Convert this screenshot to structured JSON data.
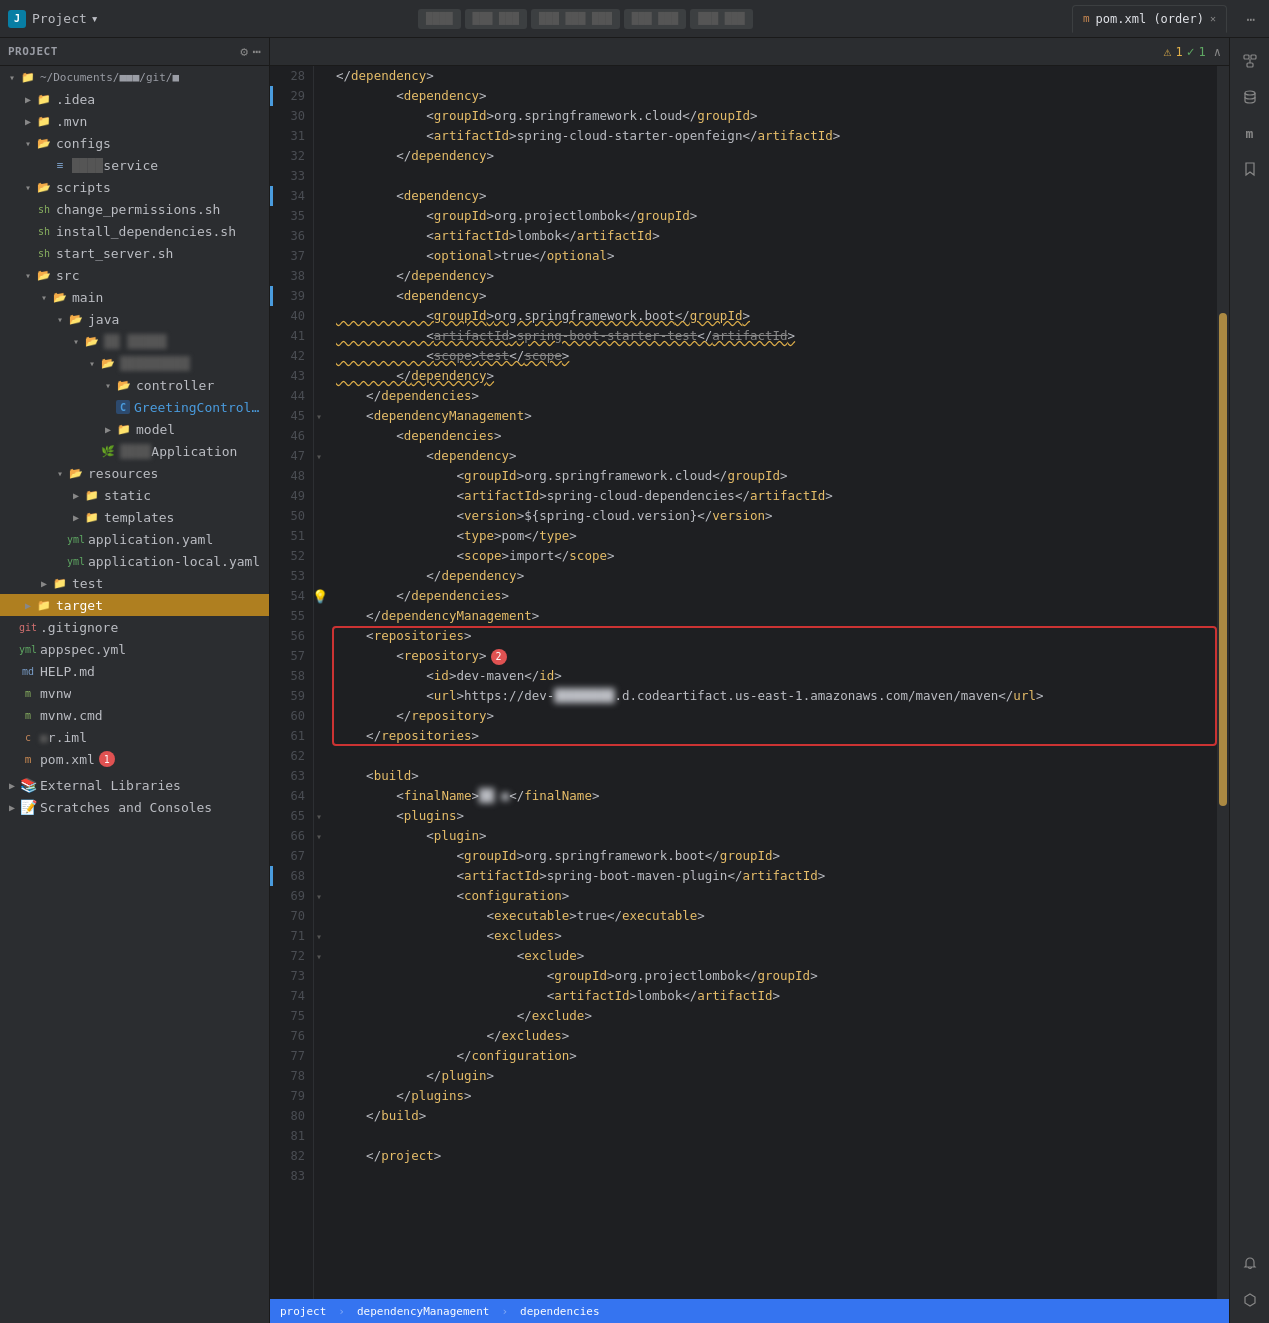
{
  "titleBar": {
    "logo": "J",
    "projectLabel": "Project",
    "dropdownIcon": "▾",
    "tabs": [
      {
        "id": "pom",
        "label": "pom.xml (order)",
        "icon": "m",
        "active": true
      }
    ],
    "actions": [
      "←",
      "→",
      "↺",
      "⋯"
    ]
  },
  "toolbar": {
    "pills": [
      "▓▓▓",
      "▓▓▓ ▓▓▓",
      "▓▓▓ ▓▓▓ ▓▓▓",
      "▓▓▓ ▓▓▓",
      "▓▓▓ ▓▓▓"
    ]
  },
  "sidebar": {
    "title": "Project",
    "rootLabel": "~/Documents/…/git/…",
    "items": [
      {
        "id": "idea",
        "label": ".idea",
        "depth": 1,
        "type": "folder",
        "expanded": false
      },
      {
        "id": "mvn",
        "label": ".mvn",
        "depth": 1,
        "type": "folder",
        "expanded": false
      },
      {
        "id": "configs",
        "label": "configs",
        "depth": 1,
        "type": "folder-open",
        "expanded": true
      },
      {
        "id": "service",
        "label": "service",
        "depth": 2,
        "type": "file-config",
        "blurred": true
      },
      {
        "id": "scripts",
        "label": "scripts",
        "depth": 1,
        "type": "folder-open",
        "expanded": true
      },
      {
        "id": "change_permissions",
        "label": "change_permissions.sh",
        "depth": 2,
        "type": "sh"
      },
      {
        "id": "install_dependencies",
        "label": "install_dependencies.sh",
        "depth": 2,
        "type": "sh"
      },
      {
        "id": "start_server",
        "label": "start_server.sh",
        "depth": 2,
        "type": "sh"
      },
      {
        "id": "src",
        "label": "src",
        "depth": 1,
        "type": "folder-open",
        "expanded": true
      },
      {
        "id": "main",
        "label": "main",
        "depth": 2,
        "type": "folder-open",
        "expanded": true
      },
      {
        "id": "java",
        "label": "java",
        "depth": 3,
        "type": "folder-open",
        "expanded": true
      },
      {
        "id": "pkg",
        "label": "■■ ■■■■■",
        "depth": 4,
        "type": "folder-open",
        "expanded": true,
        "blurred": true
      },
      {
        "id": "pkg2",
        "label": "■■■■■■■■■",
        "depth": 5,
        "type": "folder-open",
        "expanded": true,
        "blurred": true
      },
      {
        "id": "controller",
        "label": "controller",
        "depth": 6,
        "type": "folder-open",
        "expanded": true
      },
      {
        "id": "GreetingController",
        "label": "GreetingController",
        "depth": 7,
        "type": "java-class",
        "icon": "C"
      },
      {
        "id": "model",
        "label": "model",
        "depth": 6,
        "type": "folder",
        "expanded": false
      },
      {
        "id": "Application",
        "label": "■■■■Application",
        "depth": 6,
        "type": "spring",
        "blurred": true
      },
      {
        "id": "resources",
        "label": "resources",
        "depth": 3,
        "type": "folder-open",
        "expanded": true
      },
      {
        "id": "static",
        "label": "static",
        "depth": 4,
        "type": "folder",
        "expanded": false
      },
      {
        "id": "templates",
        "label": "templates",
        "depth": 4,
        "type": "folder",
        "expanded": false
      },
      {
        "id": "application_yml",
        "label": "application.yaml",
        "depth": 4,
        "type": "yml"
      },
      {
        "id": "application_local_yml",
        "label": "application-local.yaml",
        "depth": 4,
        "type": "yml"
      },
      {
        "id": "test",
        "label": "test",
        "depth": 2,
        "type": "folder",
        "expanded": false
      },
      {
        "id": "target",
        "label": "target",
        "depth": 1,
        "type": "folder-open",
        "expanded": false,
        "selected": true
      },
      {
        "id": "gitignore",
        "label": ".gitignore",
        "depth": 1,
        "type": "gitignore"
      },
      {
        "id": "appspec",
        "label": "appspec.yml",
        "depth": 1,
        "type": "yml"
      },
      {
        "id": "helpmd",
        "label": "HELP.md",
        "depth": 1,
        "type": "md"
      },
      {
        "id": "mvnw",
        "label": "mvnw",
        "depth": 1,
        "type": "sh"
      },
      {
        "id": "mvnwcmd",
        "label": "mvnw.cmd",
        "depth": 1,
        "type": "sh"
      },
      {
        "id": "riml",
        "label": "■ r.iml",
        "depth": 1,
        "type": "iml",
        "blurred": true
      },
      {
        "id": "pomxml",
        "label": "pom.xml",
        "depth": 1,
        "type": "xml",
        "badge": 1
      }
    ],
    "sections": [
      {
        "id": "external-libraries",
        "label": "External Libraries",
        "expanded": false
      },
      {
        "id": "scratches",
        "label": "Scratches and Consoles",
        "expanded": false
      }
    ]
  },
  "editorTab": {
    "icon": "m",
    "label": "pom.xml (order)",
    "closable": true
  },
  "editorToolbar": {
    "warningCount": "1",
    "errorCount": "1",
    "expandIcon": "⌃"
  },
  "codeLines": [
    {
      "num": 28,
      "content": "        </dependency>",
      "indent": 2
    },
    {
      "num": 29,
      "content": "        <dependency>",
      "indent": 2,
      "gitMark": "modified"
    },
    {
      "num": 30,
      "content": "            <groupId>org.springframework.cloud</groupId>",
      "indent": 3
    },
    {
      "num": 31,
      "content": "            <artifactId>spring-cloud-starter-openfeign</artifactId>",
      "indent": 3
    },
    {
      "num": 32,
      "content": "        </dependency>",
      "indent": 2
    },
    {
      "num": 33,
      "content": ""
    },
    {
      "num": 34,
      "content": "        <dependency>",
      "indent": 2,
      "gitMark": "modified"
    },
    {
      "num": 35,
      "content": "            <groupId>org.projectlombok</groupId>",
      "indent": 3
    },
    {
      "num": 36,
      "content": "            <artifactId>lombok</artifactId>",
      "indent": 3
    },
    {
      "num": 37,
      "content": "            <optional>true</optional>",
      "indent": 3
    },
    {
      "num": 38,
      "content": "        </dependency>",
      "indent": 2
    },
    {
      "num": 39,
      "content": "        <dependency>",
      "indent": 2,
      "gitMark": "modified"
    },
    {
      "num": 40,
      "content": "            <groupId>org.springframework.boot</groupId>",
      "indent": 3,
      "warnStyle": true
    },
    {
      "num": 41,
      "content": "            <artifactId>spring-boot-starter-test</artifactId>",
      "indent": 3,
      "warnStyle": true,
      "strike": true
    },
    {
      "num": 42,
      "content": "            <scope>test</scope>",
      "indent": 3,
      "warnStyle": true,
      "strike": true
    },
    {
      "num": 43,
      "content": "        </dependency>",
      "indent": 2,
      "warnStyle": true
    },
    {
      "num": 44,
      "content": "    </dependencies>",
      "indent": 1
    },
    {
      "num": 45,
      "content": "    <dependencyManagement>",
      "indent": 1,
      "foldable": true
    },
    {
      "num": 46,
      "content": "        <dependencies>",
      "indent": 2
    },
    {
      "num": 47,
      "content": "            <dependency>",
      "indent": 3,
      "foldable": true
    },
    {
      "num": 48,
      "content": "                <groupId>org.springframework.cloud</groupId>",
      "indent": 4
    },
    {
      "num": 49,
      "content": "                <artifactId>spring-cloud-dependencies</artifactId>",
      "indent": 4
    },
    {
      "num": 50,
      "content": "                <version>${spring-cloud.version}</version>",
      "indent": 4
    },
    {
      "num": 51,
      "content": "                <type>pom</type>",
      "indent": 4
    },
    {
      "num": 52,
      "content": "                <scope>import</scope>",
      "indent": 4
    },
    {
      "num": 53,
      "content": "            </dependency>",
      "indent": 3
    },
    {
      "num": 54,
      "content": "        </dependencies>",
      "indent": 2,
      "lightbulb": true
    },
    {
      "num": 55,
      "content": "    </dependencyManagement>",
      "indent": 1
    },
    {
      "num": 56,
      "content": "    <repositories>",
      "indent": 1,
      "errorRegionStart": true
    },
    {
      "num": 57,
      "content": "        <repository>",
      "indent": 2,
      "badge": 2
    },
    {
      "num": 58,
      "content": "            <id>dev-maven</id>",
      "indent": 3
    },
    {
      "num": 59,
      "content": "            <url>https://dev-■■■■■■■■■.d.codeartifact.us-east-1.amazonaws.com/maven/maven</url>",
      "indent": 3,
      "blurred": true
    },
    {
      "num": 60,
      "content": "        </repository>",
      "indent": 2
    },
    {
      "num": 61,
      "content": "    </repositories>",
      "indent": 1,
      "errorRegionEnd": true
    },
    {
      "num": 62,
      "content": ""
    },
    {
      "num": 63,
      "content": "    <build>",
      "indent": 1
    },
    {
      "num": 64,
      "content": "        <finalName>■■ ■</finalName>",
      "indent": 2,
      "blurred": true
    },
    {
      "num": 65,
      "content": "        <plugins>",
      "indent": 2,
      "foldable": true
    },
    {
      "num": 66,
      "content": "            <plugin>",
      "indent": 3,
      "foldable": true
    },
    {
      "num": 67,
      "content": "                <groupId>org.springframework.boot</groupId>",
      "indent": 4
    },
    {
      "num": 68,
      "content": "                <artifactId>spring-boot-maven-plugin</artifactId>",
      "indent": 4,
      "gitMark": "modified"
    },
    {
      "num": 69,
      "content": "                <configuration>",
      "indent": 4,
      "foldable": true
    },
    {
      "num": 70,
      "content": "                    <executable>true</executable>",
      "indent": 5
    },
    {
      "num": 71,
      "content": "                    <excludes>",
      "indent": 5,
      "foldable": true
    },
    {
      "num": 72,
      "content": "                        <exclude>",
      "indent": 6,
      "foldable": true
    },
    {
      "num": 73,
      "content": "                            <groupId>org.projectlombok</groupId>",
      "indent": 7
    },
    {
      "num": 74,
      "content": "                            <artifactId>lombok</artifactId>",
      "indent": 7
    },
    {
      "num": 75,
      "content": "                        </exclude>",
      "indent": 6
    },
    {
      "num": 76,
      "content": "                    </excludes>",
      "indent": 5
    },
    {
      "num": 77,
      "content": "                </configuration>",
      "indent": 4
    },
    {
      "num": 78,
      "content": "            </plugin>",
      "indent": 3
    },
    {
      "num": 79,
      "content": "        </plugins>",
      "indent": 2
    },
    {
      "num": 80,
      "content": "    </build>",
      "indent": 1
    },
    {
      "num": 81,
      "content": ""
    },
    {
      "num": 82,
      "content": "    </project>",
      "indent": 1
    },
    {
      "num": 83,
      "content": ""
    }
  ],
  "statusBar": {
    "project": "project",
    "breadcrumb1": "dependencyManagement",
    "breadcrumb2": "dependencies",
    "sep": "›"
  },
  "iconSidebar": {
    "icons": [
      {
        "id": "structure",
        "symbol": "⊞",
        "active": false
      },
      {
        "id": "database",
        "symbol": "⊙",
        "active": false
      },
      {
        "id": "maven",
        "symbol": "m",
        "active": false
      },
      {
        "id": "bookmarks",
        "symbol": "◈",
        "active": false
      },
      {
        "id": "notifications",
        "symbol": "🔔",
        "active": false
      },
      {
        "id": "plugin",
        "symbol": "⬡",
        "active": false
      }
    ]
  }
}
